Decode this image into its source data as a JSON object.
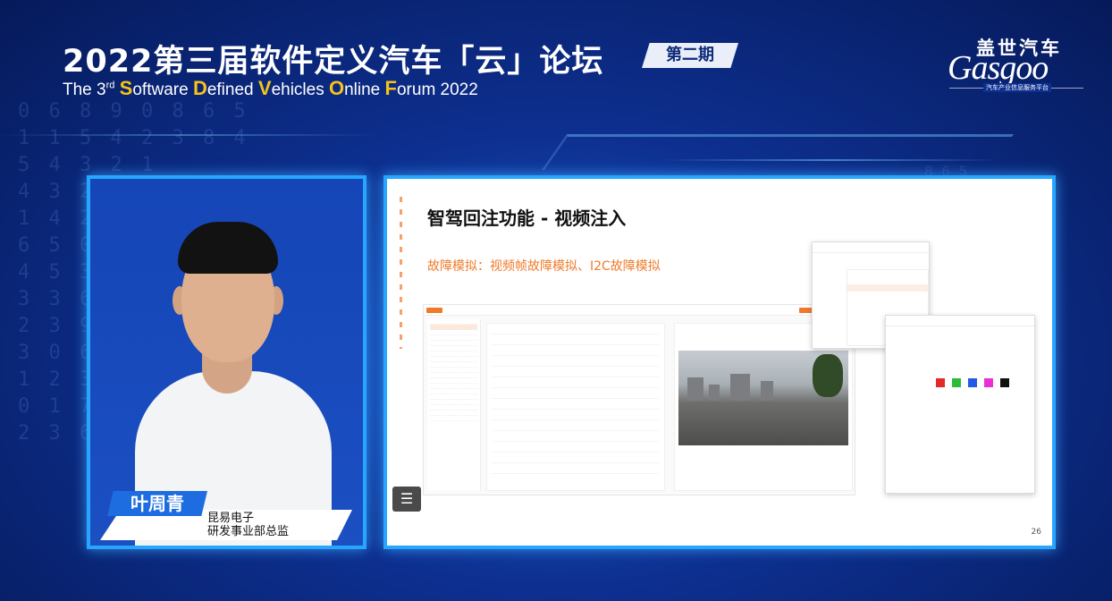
{
  "header": {
    "title_cn": "2022第三届软件定义汽车「云」论坛",
    "issue_badge": "第二期",
    "title_en_prefix": "The 3",
    "title_en_sup": "rd",
    "title_en_parts": [
      {
        "cap": "S",
        "rest": "oftware "
      },
      {
        "cap": "D",
        "rest": "efined "
      },
      {
        "cap": "V",
        "rest": "ehicles "
      },
      {
        "cap": "O",
        "rest": "nline "
      },
      {
        "cap": "F",
        "rest": "orum 2022"
      }
    ]
  },
  "logo": {
    "cn": "盖世汽车",
    "en": "Gasgoo",
    "tagline": "汽车产业信息服务平台"
  },
  "speaker": {
    "name": "叶周青",
    "company": "昆易电子",
    "title": "研发事业部总监"
  },
  "slide": {
    "title": "智驾回注功能 - 视频注入",
    "subtitle": "故障模拟：视频帧故障模拟、I2C故障模拟",
    "page_number": "26"
  },
  "colors": {
    "frame_border": "#27a6ff",
    "accent_orange": "#f07a2a",
    "highlight_yellow": "#f7c318",
    "background_blue": "#0d2f8f"
  },
  "icons": {
    "sidebar_toggle": "menu-list-icon"
  }
}
